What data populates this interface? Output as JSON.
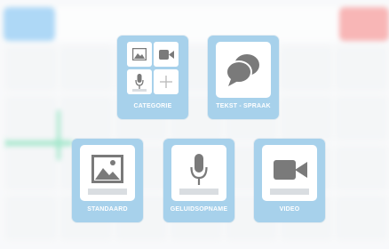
{
  "tiles": {
    "category": {
      "label": "CATEGORIE",
      "icon": "category-grid-icon"
    },
    "text_speech": {
      "label": "TEKST - SPRAAK",
      "icon": "speech-bubbles-icon"
    },
    "standard": {
      "label": "STANDAARD",
      "icon": "image-icon"
    },
    "audio": {
      "label": "GELUIDSOPNAME",
      "icon": "microphone-icon"
    },
    "video": {
      "label": "VIDEO",
      "icon": "video-camera-icon"
    }
  },
  "colors": {
    "tile_bg": "#a7d1eb",
    "icon_gray": "#7a7a7a",
    "bg_blue": "#6cb8ef",
    "bg_red": "#f27b7b",
    "bg_green": "#63d6a7"
  }
}
